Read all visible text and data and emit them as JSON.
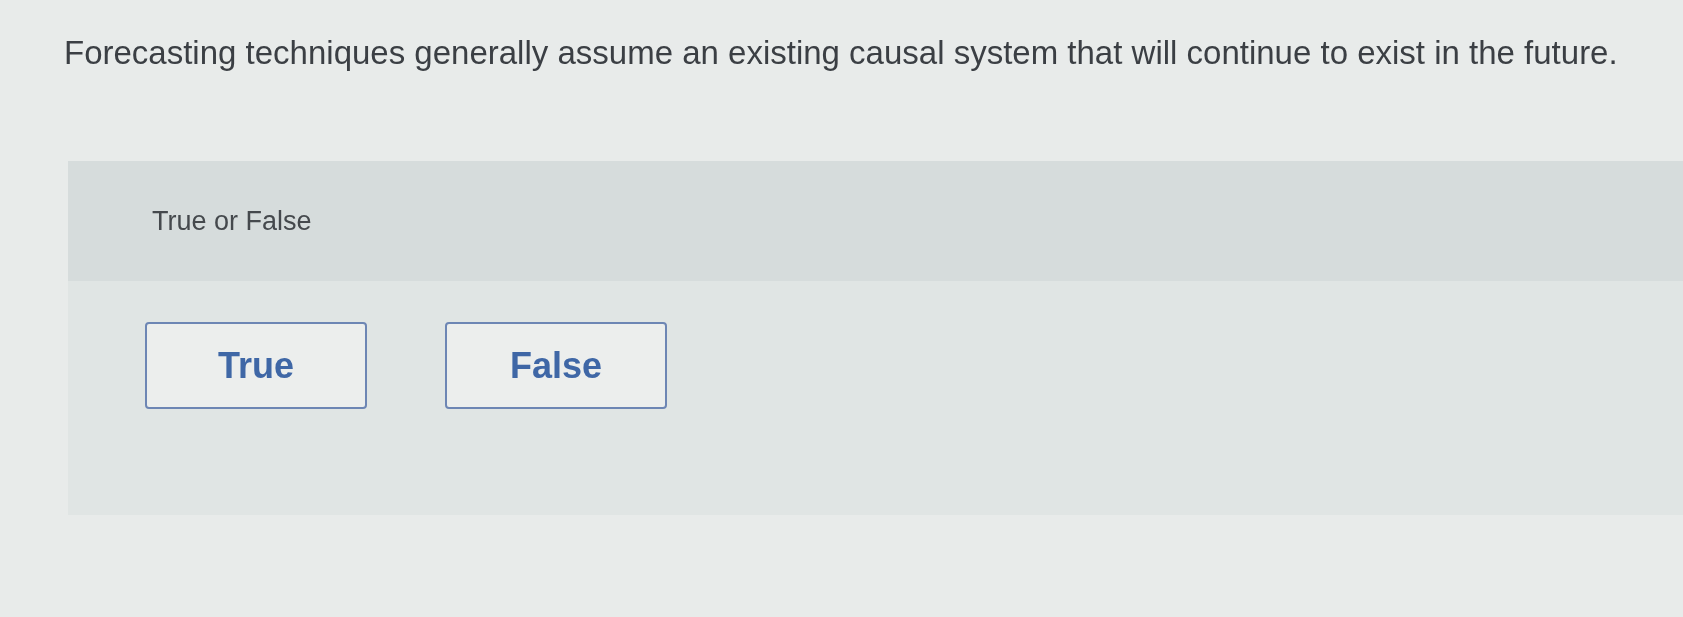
{
  "question": {
    "text": "Forecasting techniques generally assume an existing causal system that will continue to exist in the future."
  },
  "answer_panel": {
    "prompt": "True or False",
    "options": [
      {
        "label": "True",
        "selected": false
      },
      {
        "label": "False",
        "selected": false
      }
    ]
  }
}
